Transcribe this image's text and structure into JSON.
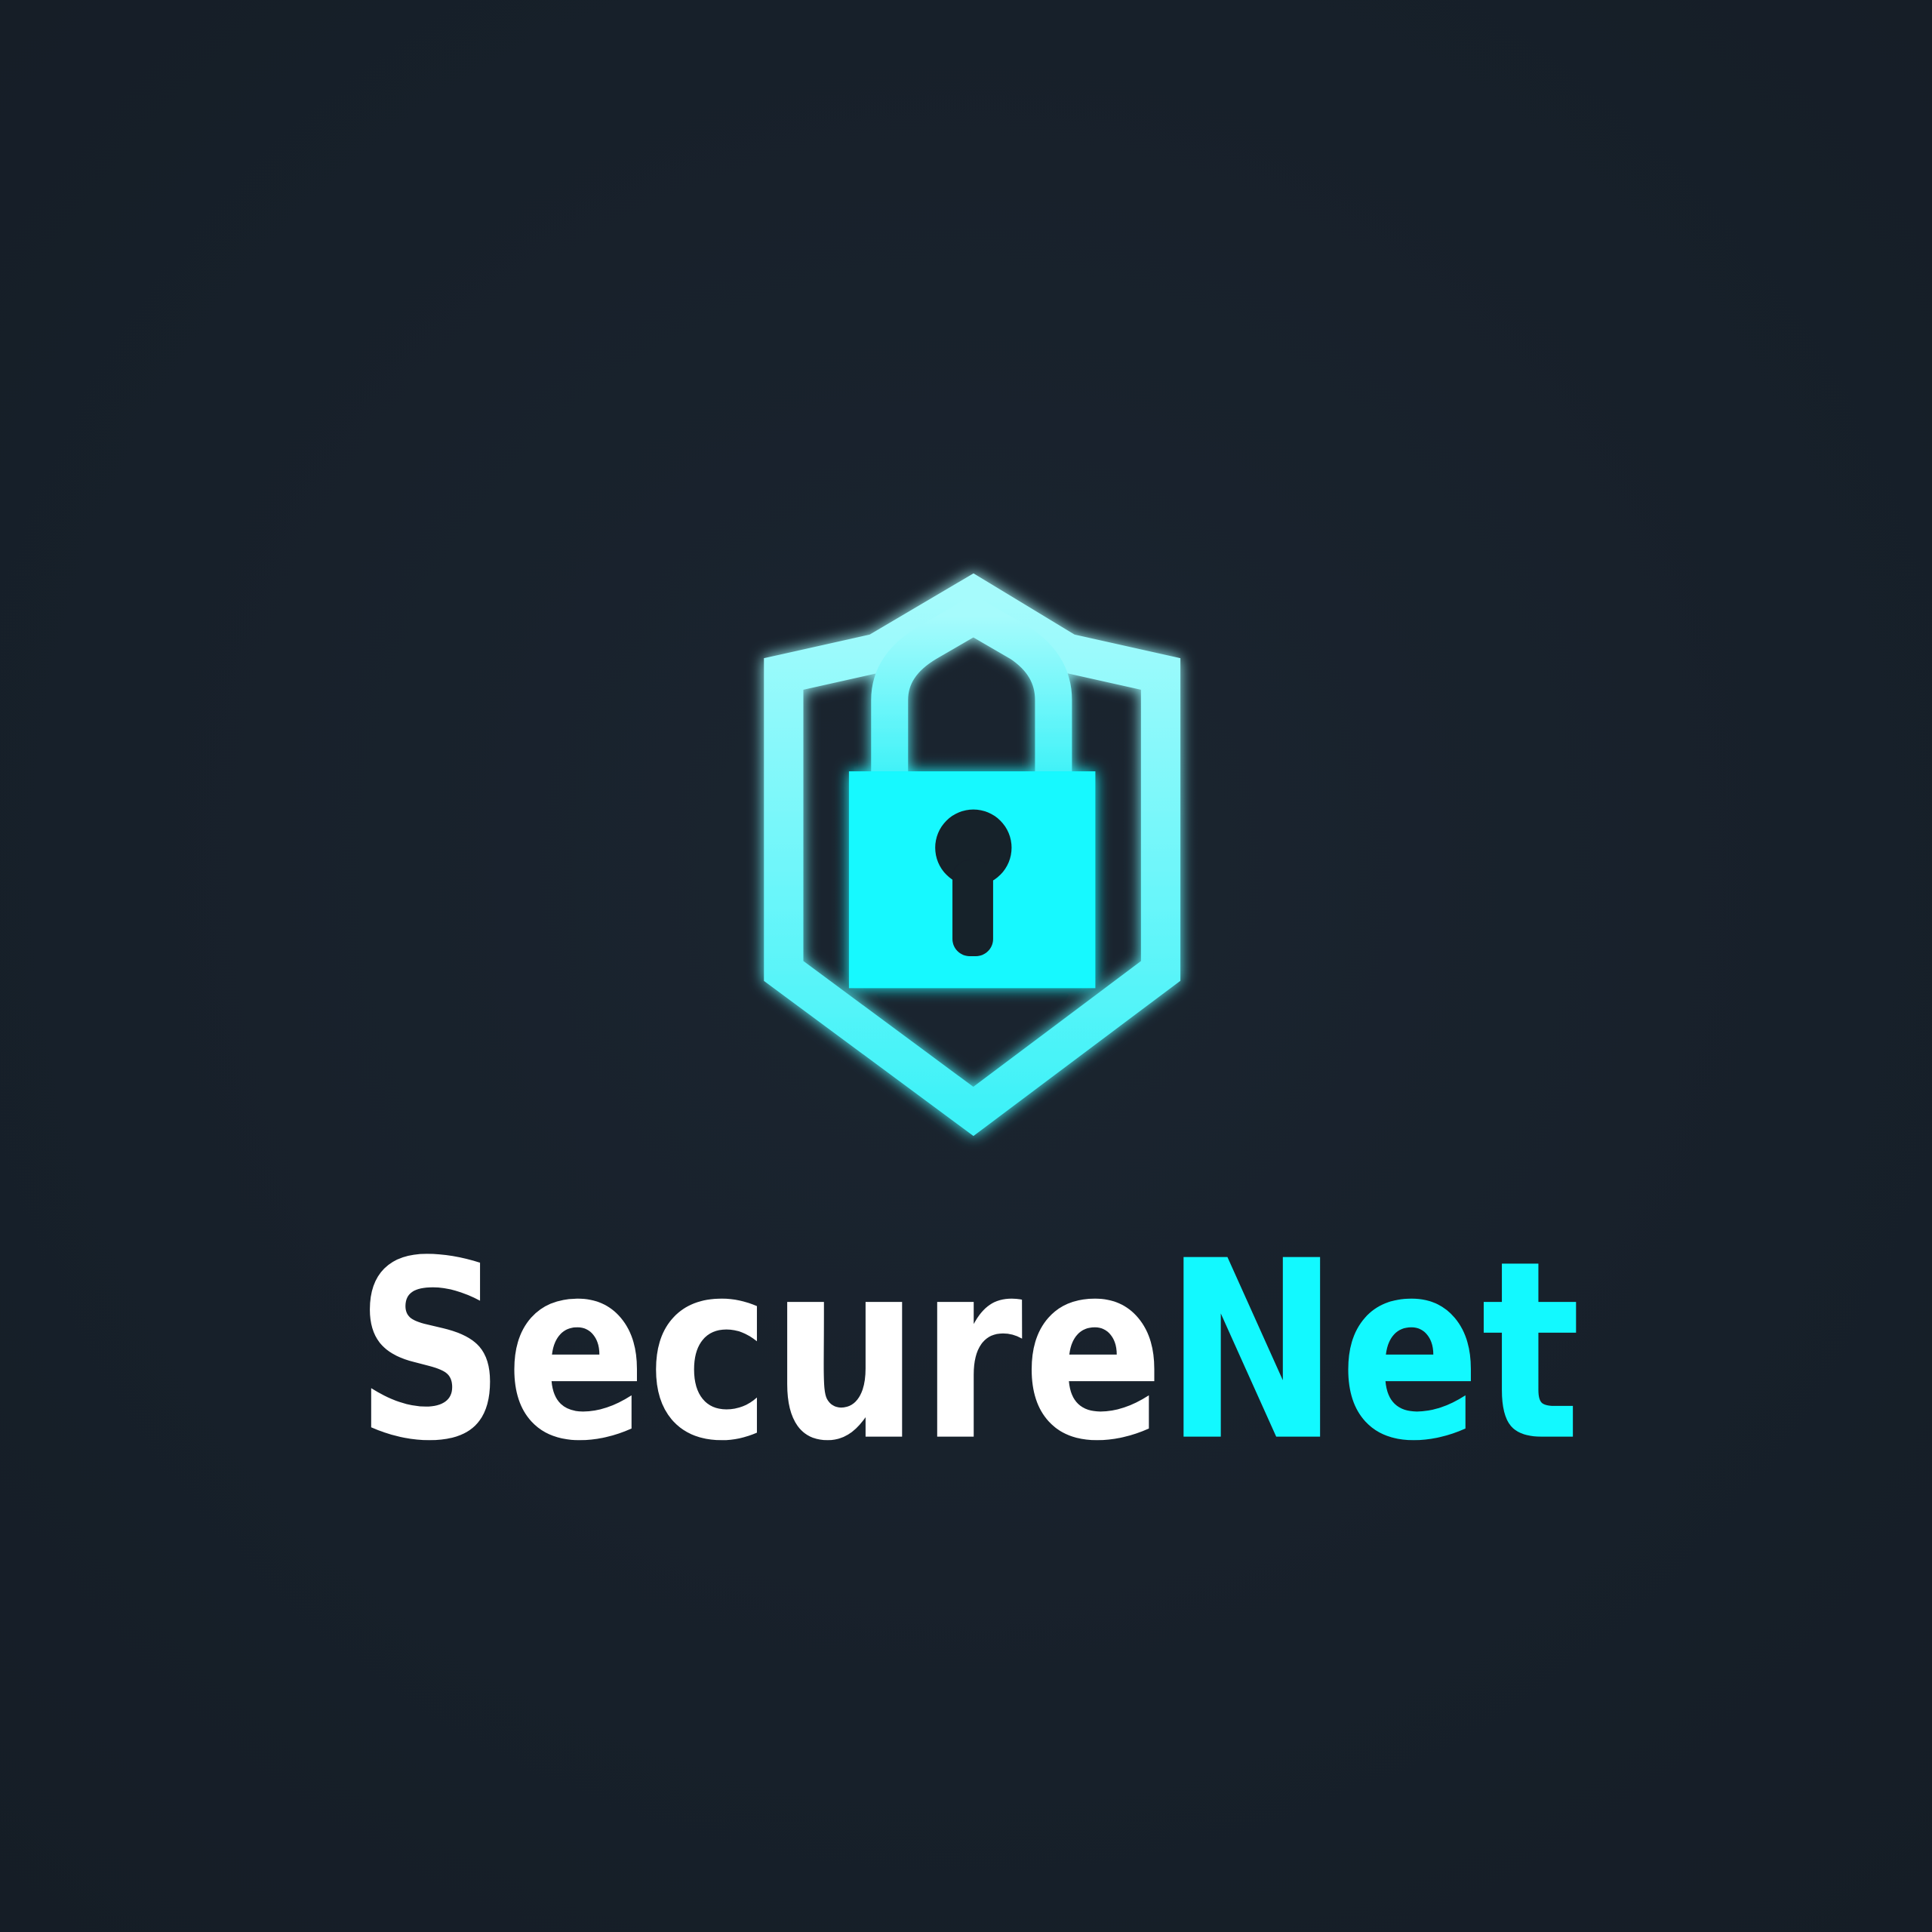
{
  "brand": {
    "name_part1": "Secure",
    "name_part2": "Net",
    "colors": {
      "background": "#17202a",
      "accent": "#12f9ff",
      "shield_light": "#a6fbfc",
      "shield_dark": "#3ef2f8",
      "text_primary": "#ffffff"
    },
    "icon": "shield-lock-icon"
  }
}
